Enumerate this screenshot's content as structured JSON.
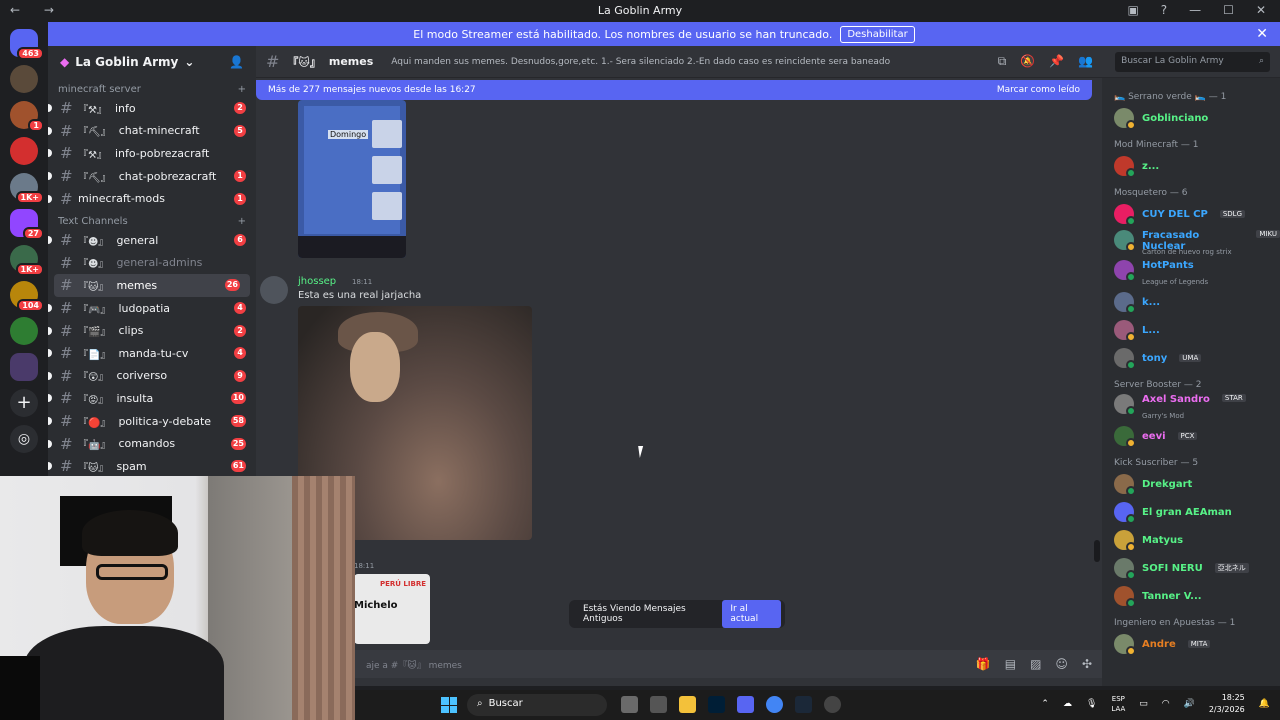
{
  "window": {
    "title": "La Goblin Army",
    "nav_glyphs": "← →"
  },
  "banner": {
    "text": "El modo Streamer está habilitado. Los nombres de usuario se han truncado.",
    "button": "Deshabilitar"
  },
  "guild_badges": [
    "463",
    "1",
    "1K+",
    "27",
    "1K+",
    "104"
  ],
  "server": {
    "name": "La Goblin Army",
    "categories": [
      {
        "name": "minecraft server",
        "channels": [
          {
            "emoji": "『⚒』",
            "name": "info",
            "badge": "2",
            "state": "unread"
          },
          {
            "emoji": "『⛏』",
            "name": "chat-minecraft",
            "badge": "5",
            "state": "unread"
          },
          {
            "emoji": "『⚒』",
            "name": "info-pobrezacraft",
            "badge": "",
            "state": "unread"
          },
          {
            "emoji": "『⛏』",
            "name": "chat-pobrezacraft",
            "badge": "1",
            "state": "unread"
          },
          {
            "emoji": "",
            "name": "minecraft-mods",
            "badge": "1",
            "state": "unread"
          }
        ]
      },
      {
        "name": "Text Channels",
        "channels": [
          {
            "emoji": "『☻』",
            "name": "general",
            "badge": "6",
            "state": "unread"
          },
          {
            "emoji": "『☻』",
            "name": "general-admins",
            "badge": "",
            "state": "dim"
          },
          {
            "emoji": "『🐱』",
            "name": "memes",
            "badge": "26",
            "state": "active"
          },
          {
            "emoji": "『🎮』",
            "name": "ludopatia",
            "badge": "4",
            "state": "unread"
          },
          {
            "emoji": "『🎬』",
            "name": "clips",
            "badge": "2",
            "state": "unread"
          },
          {
            "emoji": "『📄』",
            "name": "manda-tu-cv",
            "badge": "4",
            "state": "unread"
          },
          {
            "emoji": "『😲』",
            "name": "coriverso",
            "badge": "9",
            "state": "unread"
          },
          {
            "emoji": "『😡』",
            "name": "insulta",
            "badge": "10",
            "state": "unread"
          },
          {
            "emoji": "『🔴』",
            "name": "politica-y-debate",
            "badge": "58",
            "state": "unread"
          },
          {
            "emoji": "『🤖』",
            "name": "comandos",
            "badge": "25",
            "state": "unread"
          },
          {
            "emoji": "『🐱』",
            "name": "spam",
            "badge": "61",
            "state": "unread"
          }
        ]
      }
    ]
  },
  "channel": {
    "emoji": "『🐱』",
    "name": "memes",
    "topic": "Aqui manden sus memes. Desnudos,gore,etc. 1.- Sera silenciado 2.-En dado caso es reincidente sera baneado",
    "search_placeholder": "Buscar La Goblin Army"
  },
  "new_messages_bar": {
    "text": "Más de 277 mensajes nuevos desde las 16:27",
    "action": "Marcar como leído"
  },
  "messages": [
    {
      "image_label": "Domingo"
    },
    {
      "author": "jhossep",
      "time": "18:11",
      "text": "Esta es una real jarjacha"
    },
    {
      "time": "18:11",
      "image_texts": [
        "PERÚ LIBRE",
        "Michelo"
      ]
    }
  ],
  "old_messages": {
    "text": "Estás Viendo Mensajes Antiguos",
    "button": "Ir al actual"
  },
  "composer": {
    "placeholder": "aje a #『🐱』 memes"
  },
  "member_groups": [
    {
      "name": "🛌 Serrano verde 🛌 — 1",
      "members": [
        {
          "name": "Goblinciano",
          "color": "#57f287",
          "sub": "",
          "tag": ""
        }
      ]
    },
    {
      "name": "Mod Minecraft — 1",
      "members": [
        {
          "name": "z...",
          "color": "#57f287",
          "sub": "",
          "tag": ""
        }
      ]
    },
    {
      "name": "Mosquetero — 6",
      "members": [
        {
          "name": "CUY DEL CP",
          "color": "#3ba7ff",
          "sub": "",
          "tag": "SDLG"
        },
        {
          "name": "Fracasado Nuclear",
          "color": "#3ba7ff",
          "sub": "Carton de huevo rog strix",
          "tag": "MIKU"
        },
        {
          "name": "HotPants",
          "color": "#3ba7ff",
          "sub": "League of Legends",
          "tag": ""
        },
        {
          "name": "k...",
          "color": "#3ba7ff",
          "sub": "",
          "tag": ""
        },
        {
          "name": "L...",
          "color": "#3ba7ff",
          "sub": "",
          "tag": ""
        },
        {
          "name": "tony",
          "color": "#3ba7ff",
          "sub": "",
          "tag": "UMA"
        }
      ]
    },
    {
      "name": "Server Booster — 2",
      "members": [
        {
          "name": "Axel Sandro",
          "color": "#eb6df0",
          "sub": "Garry's Mod",
          "tag": "STAR"
        },
        {
          "name": "eevi",
          "color": "#eb6df0",
          "sub": "",
          "tag": "PCX"
        }
      ]
    },
    {
      "name": "Kick Suscriber — 5",
      "members": [
        {
          "name": "Drekgart",
          "color": "#57f287",
          "sub": "",
          "tag": ""
        },
        {
          "name": "El gran AEAman",
          "color": "#57f287",
          "sub": "",
          "tag": ""
        },
        {
          "name": "Matyus",
          "color": "#57f287",
          "sub": "",
          "tag": ""
        },
        {
          "name": "SOFI NERU",
          "color": "#57f287",
          "sub": "",
          "tag": "亞北ネル"
        },
        {
          "name": "Tanner V...",
          "color": "#57f287",
          "sub": "",
          "tag": ""
        }
      ]
    },
    {
      "name": "Ingeniero en Apuestas — 1",
      "members": [
        {
          "name": "Andre",
          "color": "#e67e22",
          "sub": "",
          "tag": "MITA"
        }
      ]
    }
  ],
  "taskbar": {
    "search": "Buscar",
    "lang": "ESP",
    "lang2": "LAA",
    "time": "18:25",
    "date": "2/3/2026"
  }
}
